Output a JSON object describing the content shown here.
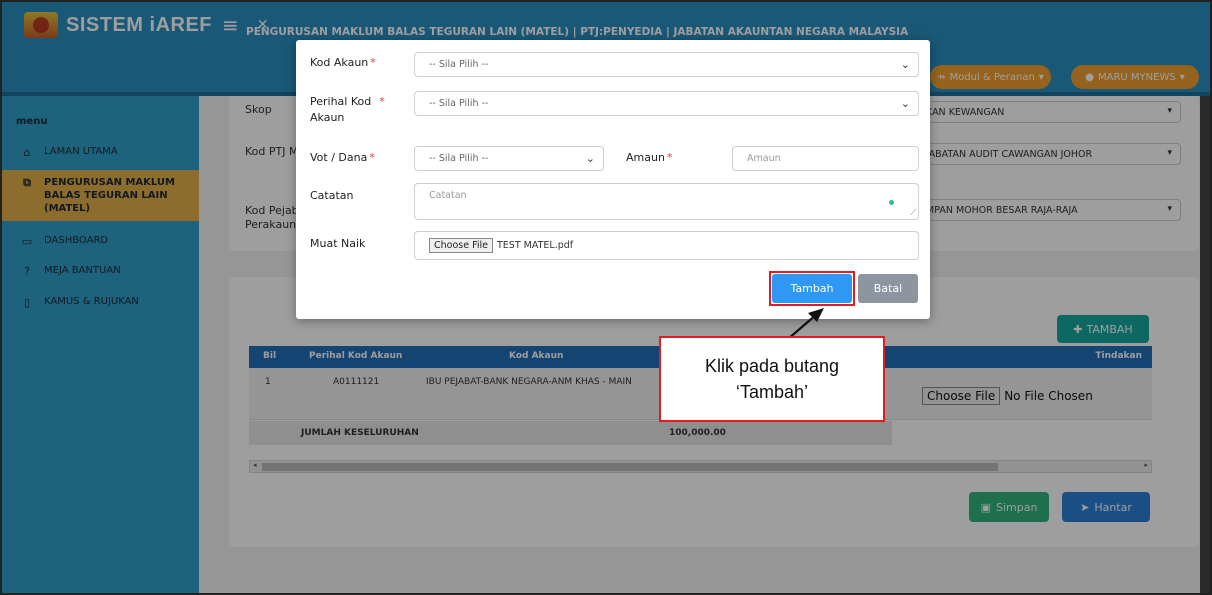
{
  "header": {
    "app_title": "SISTEM iAREF",
    "menu_toggle_glyph": "≡",
    "close_glyph": "✕",
    "page_title": "PENGURUSAN MAKLUM BALAS TEGURAN LAIN (MATEL) | PTJ:PENYEDIA | JABATAN AKAUNTAN NEGARA MALAYSIA",
    "modul_button": "Modul & Peranan",
    "user_button": "MARU MYNEWS"
  },
  "sidebar": {
    "heading": "menu",
    "items": [
      {
        "label": "LAMAN UTAMA",
        "icon": "home-icon",
        "glyph": "⌂"
      },
      {
        "label": "PENGURUSAN MAKLUM BALAS TEGURAN LAIN (MATEL)",
        "icon": "folder-icon",
        "glyph": "⧉"
      },
      {
        "label": "DASHBOARD",
        "icon": "dashboard-icon",
        "glyph": "▭"
      },
      {
        "label": "MEJA BANTUAN",
        "icon": "help-icon",
        "glyph": "?"
      },
      {
        "label": "KAMUS & RUJUKAN",
        "icon": "book-icon",
        "glyph": "▯"
      }
    ]
  },
  "form_background": {
    "skop_label": "Skop",
    "skop_value": "KAN KEWANGAN",
    "kod_ptj_label": "Kod PTJ M",
    "kod_ptj_value": "JABATAN AUDIT CAWANGAN JOHOR",
    "kod_pejabat_label_1": "Kod Pejab",
    "kod_pejabat_label_2": "Perakaun",
    "kod_pejabat_value": "MPAN MOHOR BESAR RAJA-RAJA"
  },
  "table": {
    "tambah_button": "TAMBAH",
    "columns": [
      "Bil",
      "Perihal Kod Akaun",
      "Kod Akaun",
      "Tindakan"
    ],
    "rows": [
      {
        "bil": "1",
        "perihal": "A0111121",
        "kod_akaun": "IBU PEJABAT-BANK NEGARA-ANM KHAS - MAIN"
      }
    ],
    "total_label": "JUMLAH KESELURUHAN",
    "total_value": "100,000.00",
    "file_button": "Choose File",
    "file_status": "No File Chosen"
  },
  "actions": {
    "simpan": "Simpan",
    "hantar": "Hantar"
  },
  "modal": {
    "kod_akaun_label": "Kod Akaun",
    "kod_akaun_placeholder": "-- Sila Pilih --",
    "perihal_label_1": "Perihal Kod",
    "perihal_label_2": "Akaun",
    "perihal_placeholder": "-- Sila Pilih --",
    "vot_label": "Vot / Dana",
    "vot_placeholder": "-- Sila Pilih --",
    "amaun_label": "Amaun",
    "amaun_placeholder": "Amaun",
    "catatan_label": "Catatan",
    "catatan_placeholder": "Catatan",
    "muat_naik_label": "Muat Naik",
    "choose_file": "Choose File",
    "file_name": "TEST MATEL.pdf",
    "tambah_button": "Tambah",
    "batal_button": "Batal",
    "required_mark": "*"
  },
  "callout": {
    "line1": "Klik pada butang",
    "line2": "‘Tambah’",
    "border_color": "#e31b23"
  }
}
